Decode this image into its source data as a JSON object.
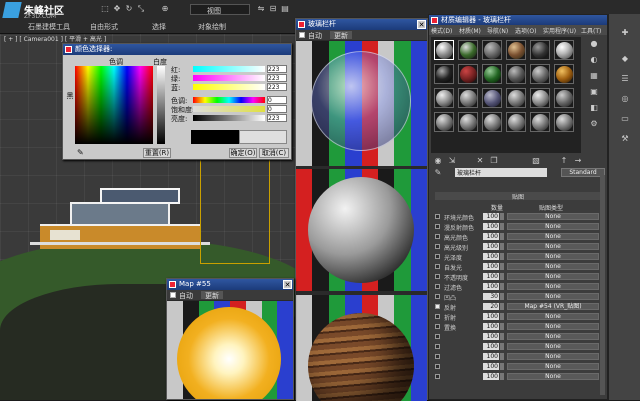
{
  "logo": {
    "text": "朱峰社区",
    "sub": "ZF3D.COM"
  },
  "menubar": {
    "items": [
      "石墨建模工具",
      "自由形式",
      "选择",
      "对象绘制"
    ],
    "viewport_label": "[ + ] [ Camera001 ] [ 平滑 + 高光 ]",
    "dropdown": "视图"
  },
  "color_picker": {
    "title": "颜色选择器:",
    "hue_label": "色调",
    "white_label": "白度",
    "black_label": "黑",
    "channels": [
      {
        "label": "红:",
        "value": "223"
      },
      {
        "label": "绿:",
        "value": "223"
      },
      {
        "label": "蓝:",
        "value": "223"
      },
      {
        "label": "色调:",
        "value": "0"
      },
      {
        "label": "饱和度:",
        "value": "0"
      },
      {
        "label": "亮度:",
        "value": "223"
      }
    ],
    "reset_button": "重置(R)",
    "ok_button": "确定(O)",
    "cancel_button": "取消(C)"
  },
  "preview_main": {
    "title": "玻璃栏杆",
    "auto_label": "自动",
    "update_label": "更新"
  },
  "preview_map": {
    "title": "Map #55",
    "auto_label": "自动",
    "update_label": "更新"
  },
  "material_editor": {
    "title": "材质编辑器 - 玻璃栏杆",
    "menus": [
      "模式(D)",
      "材质(M)",
      "导航(N)",
      "选项(O)",
      "实用程序(U)",
      "工具(T)"
    ],
    "material_name": "玻璃栏杆",
    "material_type": "Standard",
    "rollout_title": "贴图",
    "col_amount": "数量",
    "col_maptype": "贴图类型",
    "maps": [
      {
        "label": "环境光颜色",
        "amount": "100",
        "map": "None",
        "checked": false
      },
      {
        "label": "漫反射颜色",
        "amount": "100",
        "map": "None",
        "checked": false
      },
      {
        "label": "高光颜色",
        "amount": "100",
        "map": "None",
        "checked": false
      },
      {
        "label": "高光级别",
        "amount": "100",
        "map": "None",
        "checked": false
      },
      {
        "label": "光泽度",
        "amount": "100",
        "map": "None",
        "checked": false
      },
      {
        "label": "自发光",
        "amount": "100",
        "map": "None",
        "checked": false
      },
      {
        "label": "不透明度",
        "amount": "100",
        "map": "None",
        "checked": false
      },
      {
        "label": "过滤色",
        "amount": "100",
        "map": "None",
        "checked": false
      },
      {
        "label": "凹凸",
        "amount": "30",
        "map": "None",
        "checked": false
      },
      {
        "label": "反射",
        "amount": "20",
        "map": "Map #54 (VR_贴图)",
        "checked": true
      },
      {
        "label": "折射",
        "amount": "100",
        "map": "None",
        "checked": false
      },
      {
        "label": "置换",
        "amount": "100",
        "map": "None",
        "checked": false
      },
      {
        "label": "",
        "amount": "100",
        "map": "None",
        "checked": false
      },
      {
        "label": "",
        "amount": "100",
        "map": "None",
        "checked": false
      },
      {
        "label": "",
        "amount": "100",
        "map": "None",
        "checked": false
      },
      {
        "label": "",
        "amount": "100",
        "map": "None",
        "checked": false
      },
      {
        "label": "",
        "amount": "100",
        "map": "None",
        "checked": false
      }
    ]
  }
}
